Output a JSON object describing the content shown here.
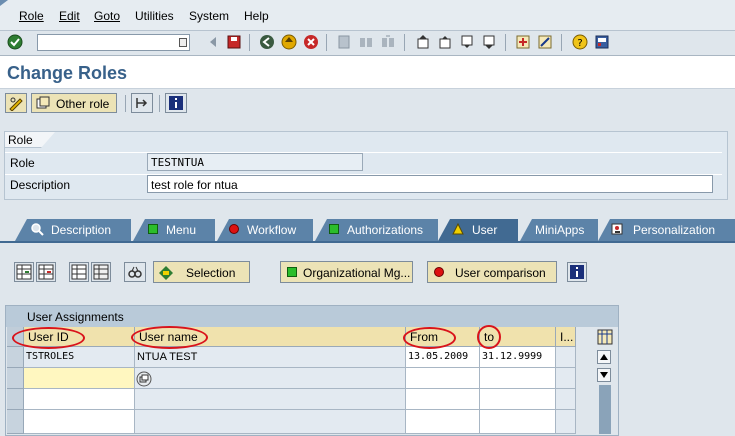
{
  "menu": [
    "Role",
    "Edit",
    "Goto",
    "Utilities",
    "System",
    "Help"
  ],
  "page_title": "Change Roles",
  "app_toolbar": {
    "other_role_label": "Other role"
  },
  "role_frame": {
    "header": "Role",
    "role_label": "Role",
    "role_value": "TESTNTUA",
    "description_label": "Description",
    "description_value": "test role for ntua"
  },
  "tabs": [
    {
      "label": "Description",
      "icon": "magnifier-icon"
    },
    {
      "label": "Menu",
      "icon": "green-status-icon"
    },
    {
      "label": "Workflow",
      "icon": "red-status-icon"
    },
    {
      "label": "Authorizations",
      "icon": "green-status-icon"
    },
    {
      "label": "User",
      "icon": "yellow-warning-icon",
      "active": true
    },
    {
      "label": "MiniApps",
      "icon": ""
    },
    {
      "label": "Personalization",
      "icon": "personalization-icon"
    }
  ],
  "user_tab": {
    "selection_label": "Selection",
    "org_mgmt_label": "Organizational Mg...",
    "user_comparison_label": "User comparison",
    "table_title": "User Assignments",
    "columns": [
      "User ID",
      "User name",
      "From",
      "to",
      "I..."
    ],
    "rows": [
      {
        "user_id": "TSTROLES",
        "user_name": "NTUA TEST",
        "from": "13.05.2009",
        "to": "31.12.9999"
      }
    ]
  },
  "colors": {
    "accent_title": "#38618a",
    "tab_bg": "#5c83a8",
    "header_cell": "#f0e2ad",
    "annotation_circle": "#d9131b"
  }
}
